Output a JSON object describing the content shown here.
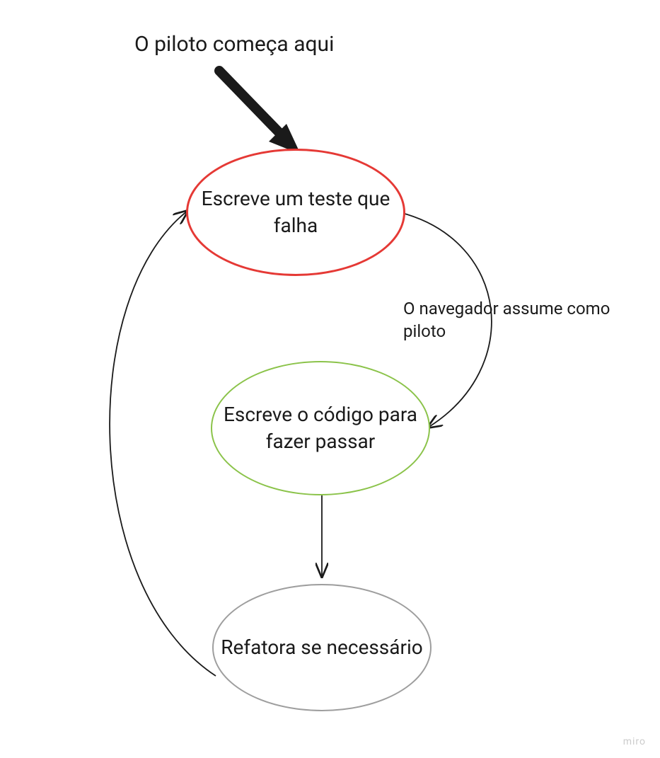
{
  "title": "O piloto começa aqui",
  "nodes": {
    "red": {
      "text": "Escreve um teste que falha",
      "color": "#e53935"
    },
    "green": {
      "text": "Escreve o código para fazer passar",
      "color": "#8bc34a"
    },
    "gray": {
      "text": "Refatora se necessário",
      "color": "#9e9e9e"
    }
  },
  "edgeLabel": "O navegador assume como piloto",
  "watermark": "miro"
}
